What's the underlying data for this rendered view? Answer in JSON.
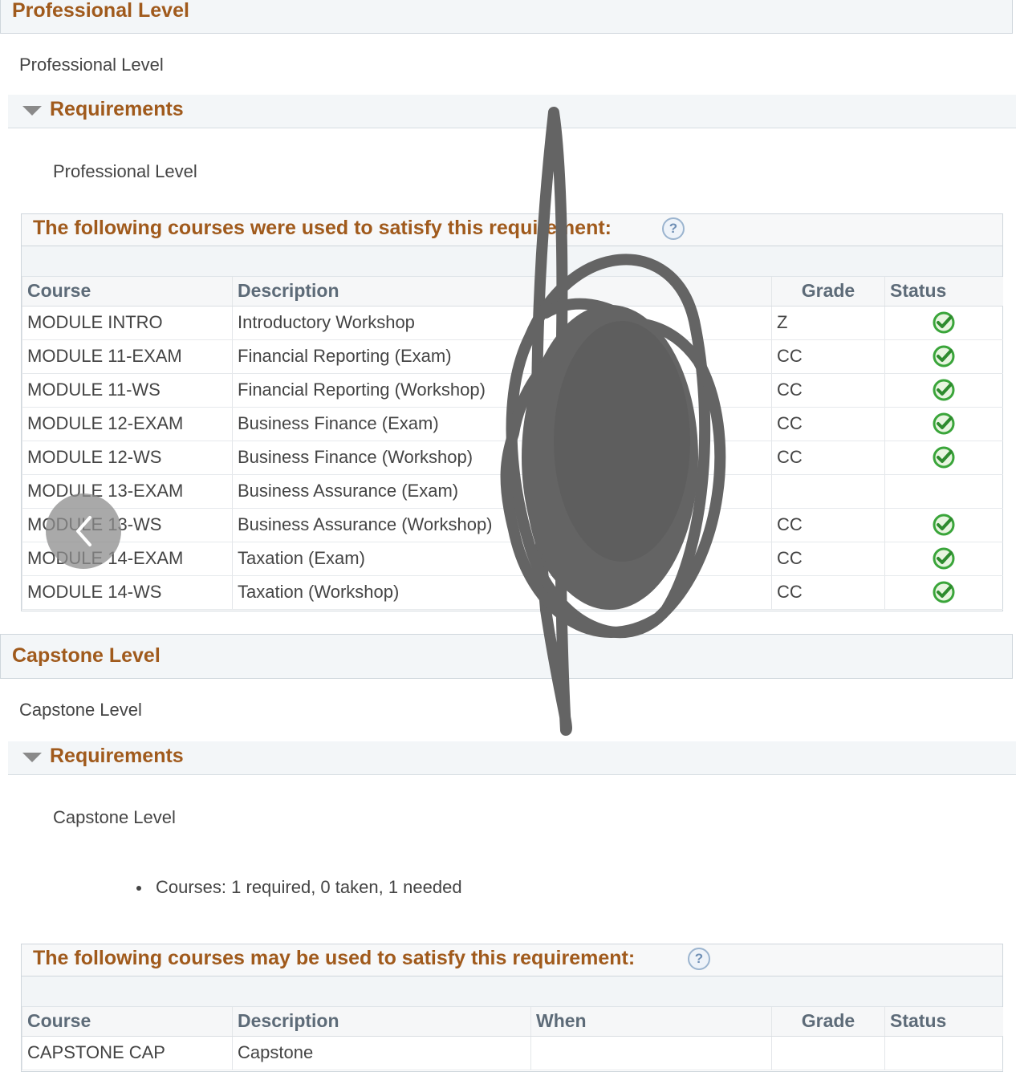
{
  "professional": {
    "section_title": "Professional Level",
    "subtitle": "Professional Level",
    "requirements_label": "Requirements",
    "requirement_desc": "Professional Level",
    "grid_title": "The following courses were used to satisfy this requirement:",
    "help_icon": "?",
    "columns": [
      "Course",
      "Description",
      "Grade",
      "Status"
    ],
    "rows": [
      {
        "course": "MODULE INTRO",
        "description": "Introductory Workshop",
        "grade": "Z",
        "status": "check"
      },
      {
        "course": "MODULE 11-EXAM",
        "description": "Financial Reporting (Exam)",
        "grade": "CC",
        "status": "check"
      },
      {
        "course": "MODULE 11-WS",
        "description": "Financial Reporting (Workshop)",
        "grade": "CC",
        "status": "check"
      },
      {
        "course": "MODULE 12-EXAM",
        "description": "Business Finance (Exam)",
        "grade": "CC",
        "status": "check"
      },
      {
        "course": "MODULE 12-WS",
        "description": "Business Finance (Workshop)",
        "grade": "CC",
        "status": "check"
      },
      {
        "course": "MODULE 13-EXAM",
        "description": "Business Assurance (Exam)",
        "grade": "",
        "status": ""
      },
      {
        "course": "MODULE 13-WS",
        "description": "Business Assurance (Workshop)",
        "grade": "CC",
        "status": "check"
      },
      {
        "course": "MODULE 14-EXAM",
        "description": "Taxation (Exam)",
        "grade": "CC",
        "status": "check"
      },
      {
        "course": "MODULE 14-WS",
        "description": "Taxation (Workshop)",
        "grade": "CC",
        "status": "check"
      }
    ]
  },
  "capstone": {
    "section_title": "Capstone Level",
    "subtitle": "Capstone Level",
    "requirements_label": "Requirements",
    "requirement_desc": "Capstone Level",
    "courses_summary": "Courses: 1 required, 0 taken, 1 needed",
    "grid_title": "The following courses may be used to satisfy this requirement:",
    "help_icon": "?",
    "columns": [
      "Course",
      "Description",
      "When",
      "Grade",
      "Status"
    ],
    "rows": [
      {
        "course": "CAPSTONE CAP",
        "description": "Capstone",
        "when": "",
        "grade": "",
        "status": ""
      }
    ]
  },
  "icons": {
    "status_check": "check-circle-icon",
    "collapse": "triangle-down-icon",
    "back": "chevron-left-icon",
    "help": "help-circle-icon"
  },
  "colors": {
    "heading": "#a05a1c",
    "check_green": "#3aa53a",
    "scribble": "#646464"
  }
}
